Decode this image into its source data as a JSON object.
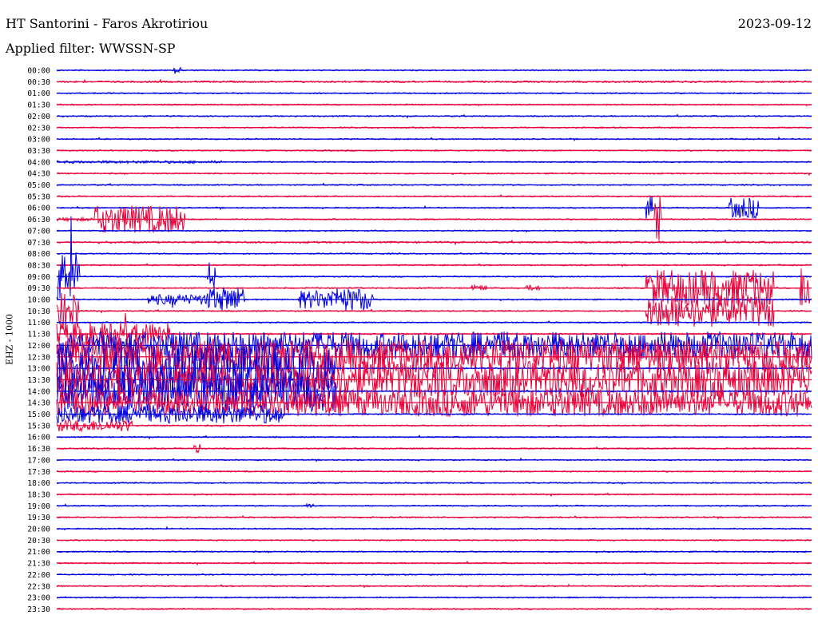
{
  "header": {
    "title": "HT Santorini - Faros Akrotiriou",
    "date": "2023-09-12",
    "filter_label": "Applied filter: WWSSN-SP"
  },
  "colors": {
    "trace_a": "#0000e0",
    "trace_b": "#e8003a",
    "background": "#ffffff"
  },
  "chart_data": {
    "type": "line",
    "title": "HT Santorini - Faros Akrotiriou",
    "ylabel": "EHZ - 1000",
    "xlabel": "",
    "grid": false,
    "legend": "none",
    "row_labels": [
      "00:00",
      "00:30",
      "01:00",
      "01:30",
      "02:00",
      "02:30",
      "03:00",
      "03:30",
      "04:00",
      "04:30",
      "05:00",
      "05:30",
      "06:00",
      "06:30",
      "07:00",
      "07:30",
      "08:00",
      "08:30",
      "09:00",
      "09:30",
      "10:00",
      "10:30",
      "11:00",
      "11:30",
      "12:00",
      "12:30",
      "13:00",
      "13:30",
      "14:00",
      "14:30",
      "15:00",
      "15:30",
      "16:00",
      "16:30",
      "17:00",
      "17:30",
      "18:00",
      "18:30",
      "19:00",
      "19:30",
      "20:00",
      "20:30",
      "21:00",
      "21:30",
      "22:00",
      "22:30",
      "23:00",
      "23:30"
    ],
    "row_minutes": 30,
    "activity": [
      {
        "row": 0,
        "start": 0.0,
        "end": 1.0,
        "level": 0.05
      },
      {
        "row": 0,
        "start": 0.155,
        "end": 0.165,
        "level": 0.35
      },
      {
        "row": 1,
        "start": 0.0,
        "end": 1.0,
        "level": 0.08
      },
      {
        "row": 5,
        "start": 0.0,
        "end": 1.0,
        "level": 0.03
      },
      {
        "row": 8,
        "start": 0.0,
        "end": 0.22,
        "level": 0.12
      },
      {
        "row": 12,
        "start": 0.78,
        "end": 0.79,
        "level": 1.0
      },
      {
        "row": 12,
        "start": 0.89,
        "end": 0.93,
        "level": 0.9
      },
      {
        "row": 13,
        "start": 0.0,
        "end": 0.05,
        "level": 0.15
      },
      {
        "row": 13,
        "start": 0.05,
        "end": 0.17,
        "level": 1.2
      },
      {
        "row": 13,
        "start": 0.79,
        "end": 0.8,
        "level": 2.0
      },
      {
        "row": 15,
        "start": 0.0,
        "end": 1.0,
        "level": 0.08
      },
      {
        "row": 18,
        "start": 0.0,
        "end": 0.03,
        "level": 2.2
      },
      {
        "row": 18,
        "start": 0.2,
        "end": 0.21,
        "level": 1.4
      },
      {
        "row": 19,
        "start": 0.55,
        "end": 0.57,
        "level": 0.25
      },
      {
        "row": 19,
        "start": 0.62,
        "end": 0.64,
        "level": 0.25
      },
      {
        "row": 19,
        "start": 0.78,
        "end": 0.95,
        "level": 1.6
      },
      {
        "row": 19,
        "start": 0.985,
        "end": 1.0,
        "level": 2.0
      },
      {
        "row": 20,
        "start": 0.12,
        "end": 0.2,
        "level": 0.45
      },
      {
        "row": 20,
        "start": 0.2,
        "end": 0.25,
        "level": 1.1
      },
      {
        "row": 20,
        "start": 0.32,
        "end": 0.36,
        "level": 0.8
      },
      {
        "row": 20,
        "start": 0.36,
        "end": 0.42,
        "level": 1.0
      },
      {
        "row": 21,
        "start": 0.0,
        "end": 0.03,
        "level": 1.6
      },
      {
        "row": 21,
        "start": 0.78,
        "end": 0.95,
        "level": 1.4
      },
      {
        "row": 23,
        "start": 0.0,
        "end": 0.15,
        "level": 1.0
      },
      {
        "row": 24,
        "start": 0.0,
        "end": 1.0,
        "level": 1.2
      },
      {
        "row": 25,
        "start": 0.0,
        "end": 1.0,
        "level": 1.5
      },
      {
        "row": 26,
        "start": 0.0,
        "end": 0.37,
        "level": 2.0
      },
      {
        "row": 27,
        "start": 0.0,
        "end": 1.0,
        "level": 1.6
      },
      {
        "row": 28,
        "start": 0.0,
        "end": 0.37,
        "level": 1.8
      },
      {
        "row": 29,
        "start": 0.0,
        "end": 1.0,
        "level": 1.2
      },
      {
        "row": 30,
        "start": 0.0,
        "end": 0.3,
        "level": 0.8
      },
      {
        "row": 31,
        "start": 0.0,
        "end": 0.1,
        "level": 0.5
      },
      {
        "row": 33,
        "start": 0.18,
        "end": 0.19,
        "level": 0.4
      },
      {
        "row": 36,
        "start": 0.0,
        "end": 1.0,
        "level": 0.06
      },
      {
        "row": 38,
        "start": 0.33,
        "end": 0.34,
        "level": 0.2
      }
    ]
  }
}
